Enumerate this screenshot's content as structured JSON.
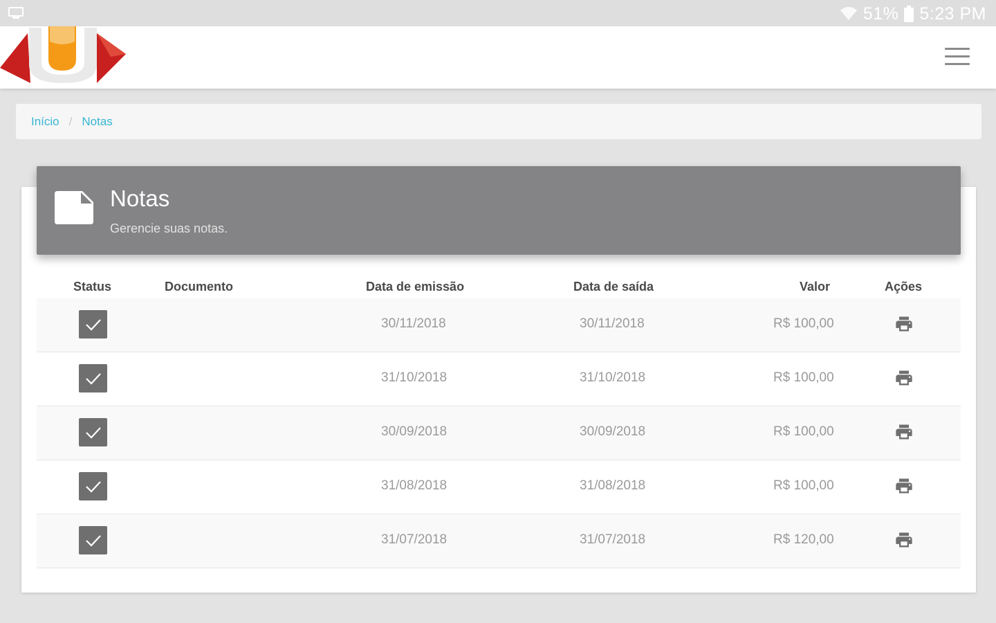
{
  "status_bar": {
    "battery": "51%",
    "time": "5:23 PM"
  },
  "breadcrumb": [
    {
      "label": "Início"
    },
    {
      "label": "Notas"
    }
  ],
  "breadcrumb_separator": "/",
  "header": {
    "title": "Notas",
    "subtitle": "Gerencie suas notas."
  },
  "table": {
    "columns": [
      "Status",
      "Documento",
      "Data de emissão",
      "Data de saída",
      "Valor",
      "Ações"
    ],
    "rows": [
      {
        "document": "",
        "issue_date": "30/11/2018",
        "exit_date": "30/11/2018",
        "value": "R$ 100,00"
      },
      {
        "document": "",
        "issue_date": "31/10/2018",
        "exit_date": "31/10/2018",
        "value": "R$ 100,00"
      },
      {
        "document": "",
        "issue_date": "30/09/2018",
        "exit_date": "30/09/2018",
        "value": "R$ 100,00"
      },
      {
        "document": "",
        "issue_date": "31/08/2018",
        "exit_date": "31/08/2018",
        "value": "R$ 100,00"
      },
      {
        "document": "",
        "issue_date": "31/07/2018",
        "exit_date": "31/07/2018",
        "value": "R$ 120,00"
      }
    ]
  },
  "icons": {
    "status_bar_left": "cast-icon",
    "status_bar_right": [
      "wifi-icon",
      "battery-icon"
    ],
    "header": "document-icon",
    "row_status": "checkbox-checked-icon",
    "row_action": "print-icon",
    "menu": "hamburger-menu-icon"
  },
  "colors": {
    "header_bg": "#848486",
    "link": "#35b6d2",
    "checkbox": "#6f6f6f",
    "logo_red": "#c8201f",
    "logo_orange": "#f59a16"
  }
}
